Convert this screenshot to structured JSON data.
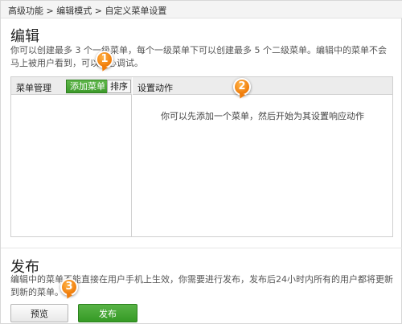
{
  "breadcrumb": {
    "items": [
      "高级功能",
      "编辑模式",
      "自定义菜单设置"
    ],
    "separator": ">"
  },
  "edit_section": {
    "title": "编辑",
    "description": "你可以创建最多 3 个一级菜单，每个一级菜单下可以创建最多 5 个二级菜单。编辑中的菜单不会马上被用户看到，可以放心调试。"
  },
  "menu_panel": {
    "header_label": "菜单管理",
    "add_button_label": "添加菜单",
    "sort_button_label": "排序"
  },
  "action_panel": {
    "header_label": "设置动作",
    "empty_hint": "你可以先添加一个菜单，然后开始为其设置响应动作"
  },
  "publish_section": {
    "title": "发布",
    "description": "编辑中的菜单不能直接在用户手机上生效，你需要进行发布，发布后24小时内所有的用户都将更新到新的菜单。",
    "preview_button_label": "预览",
    "publish_button_label": "发布"
  },
  "step_badges": [
    "1",
    "2",
    "3"
  ],
  "colors": {
    "accent_green": "#3c9a2a",
    "badge_orange": "#f07d0b"
  }
}
